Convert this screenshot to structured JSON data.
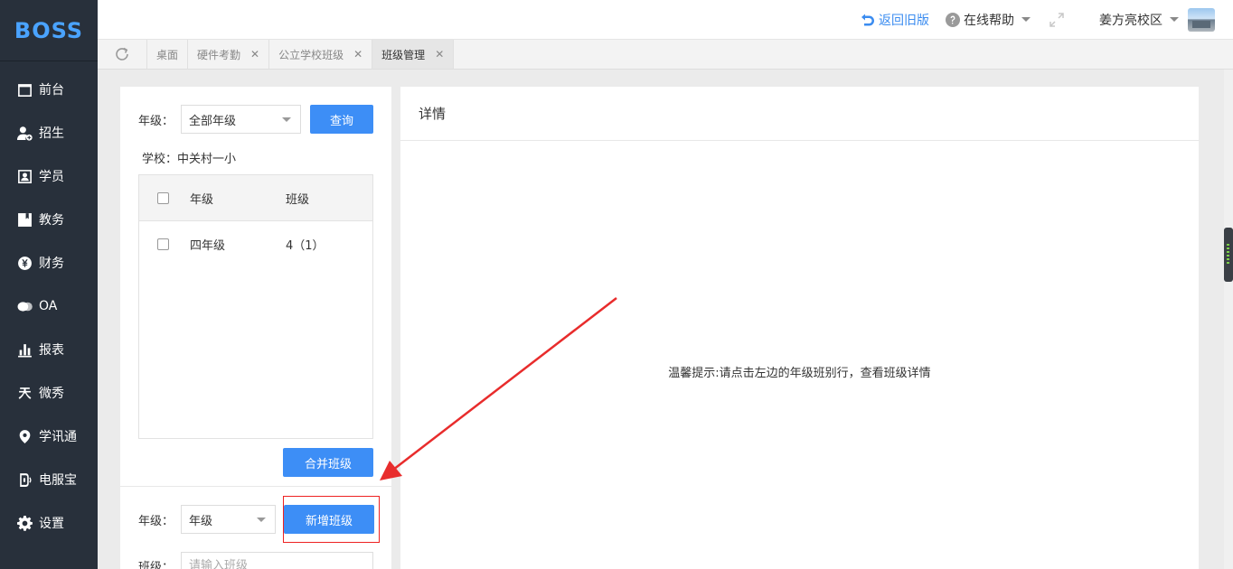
{
  "brand": {
    "logo": "BOSS",
    "accent": "#3d8ef6"
  },
  "sidebar": {
    "items": [
      {
        "label": "前台",
        "icon": "calendar-icon"
      },
      {
        "label": "招生",
        "icon": "user-add-icon"
      },
      {
        "label": "学员",
        "icon": "id-card-icon"
      },
      {
        "label": "教务",
        "icon": "book-icon"
      },
      {
        "label": "财务",
        "icon": "yen-icon"
      },
      {
        "label": "OA",
        "icon": "chat-icon"
      },
      {
        "label": "报表",
        "icon": "bar-chart-icon"
      },
      {
        "label": "微秀",
        "icon": "weixiu-icon"
      },
      {
        "label": "学讯通",
        "icon": "location-icon"
      },
      {
        "label": "电服宝",
        "icon": "headset-icon"
      },
      {
        "label": "设置",
        "icon": "gear-icon"
      }
    ]
  },
  "topbar": {
    "back_label": "返回旧版",
    "help_label": "在线帮助",
    "campus_label": "姜方亮校区"
  },
  "tabs": [
    {
      "label": "桌面",
      "closable": false
    },
    {
      "label": "硬件考勤",
      "closable": true
    },
    {
      "label": "公立学校班级",
      "closable": true
    },
    {
      "label": "班级管理",
      "closable": true,
      "active": true
    }
  ],
  "left_panel": {
    "grade_label": "年级：",
    "grade_select": "全部年级",
    "query_button": "查询",
    "school_text": "学校：中关村一小",
    "table": {
      "headers": [
        "年级",
        "班级"
      ],
      "rows": [
        {
          "grade": "四年级",
          "class": "4（1）"
        }
      ]
    },
    "merge_button": "合并班级",
    "add": {
      "grade_label": "年级：",
      "grade_select": "年级",
      "add_button": "新增班级",
      "class_label": "班级：",
      "class_placeholder": "请输入班级"
    }
  },
  "right_panel": {
    "title": "详情",
    "tip": "温馨提示:请点击左边的年级班别行，查看班级详情"
  }
}
